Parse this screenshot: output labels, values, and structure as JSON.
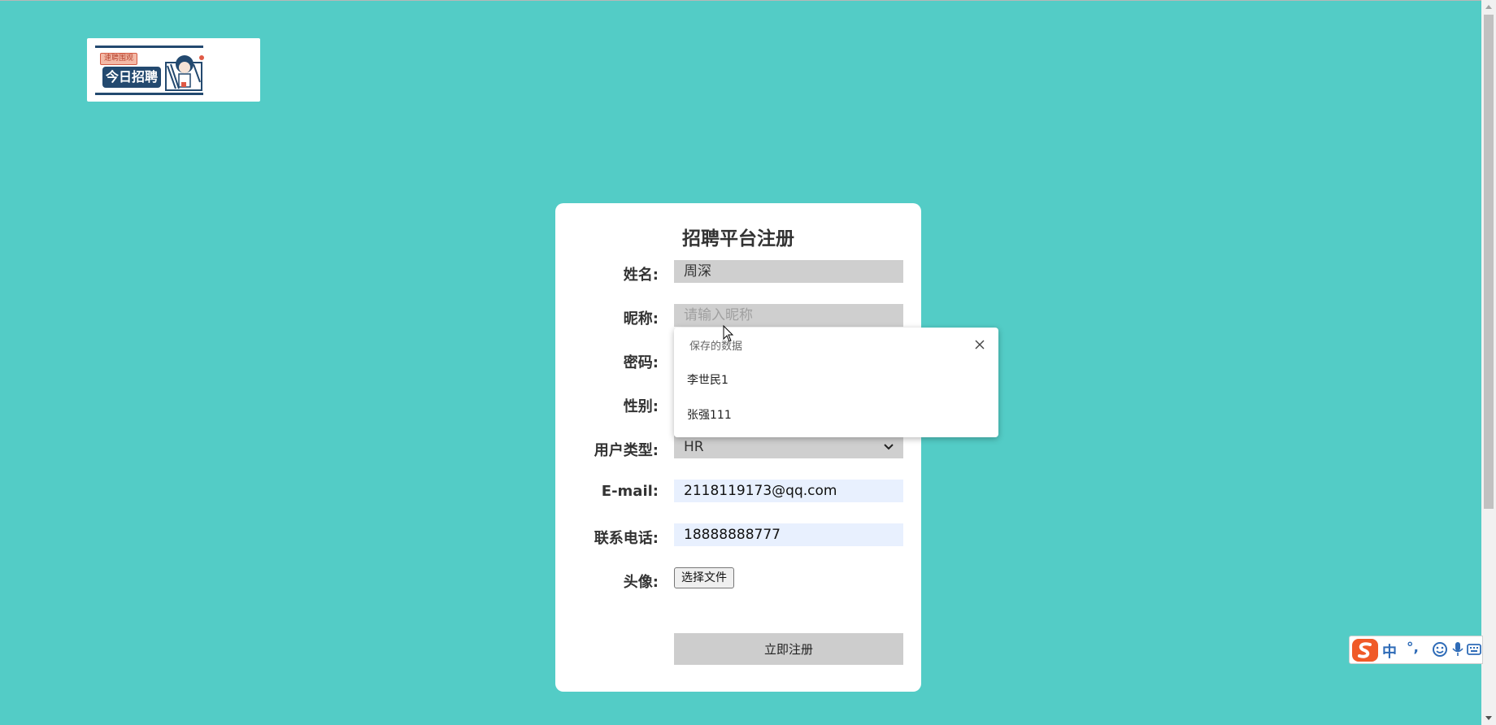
{
  "logo": {
    "tag": "速聘围观",
    "main": "今日招聘"
  },
  "form": {
    "title": "招聘平台注册",
    "name_label": "姓名:",
    "name_value": "周深",
    "nickname_label": "昵称:",
    "nickname_placeholder": "请输入昵称",
    "password_label": "密码:",
    "gender_label": "性别:",
    "usertype_label": "用户类型:",
    "usertype_value": "HR",
    "email_label": "E-mail:",
    "email_value": "2118119173@qq.com",
    "phone_label": "联系电话:",
    "phone_value": "18888888777",
    "avatar_label": "头像:",
    "file_button": "选择文件",
    "submit": "立即注册"
  },
  "autofill": {
    "title": "保存的数据",
    "items": [
      "李世民1",
      "张强111"
    ]
  },
  "ime": {
    "lang": "中",
    "punct": "°,"
  },
  "colors": {
    "background": "#53ccc6",
    "card": "#ffffff",
    "field": "#cfcfcf",
    "autofill_field": "#e8f0fe"
  }
}
